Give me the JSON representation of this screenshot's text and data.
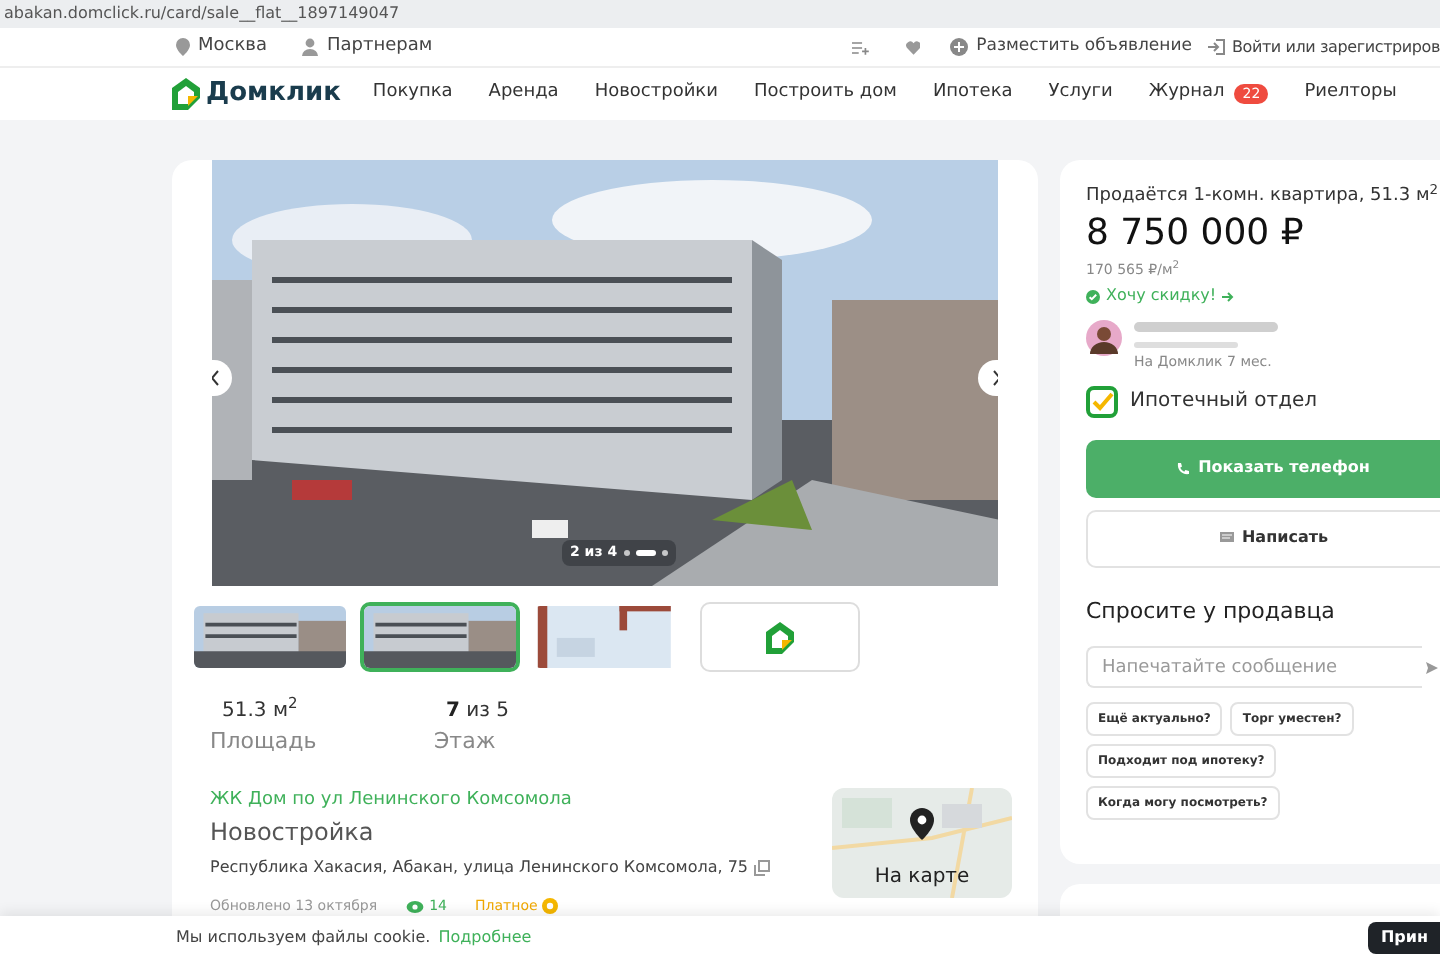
{
  "browser": {
    "url": "abakan.domclick.ru/card/sale__flat__1897149047"
  },
  "top_bar": {
    "city": "Москва",
    "partners": "Партнерам",
    "post_ad": "Разместить объявление",
    "login": "Войти или зарегистриров"
  },
  "nav": {
    "logo": "Домклик",
    "items": [
      {
        "label": "Покупка"
      },
      {
        "label": "Аренда"
      },
      {
        "label": "Новостройки"
      },
      {
        "label": "Построить дом"
      },
      {
        "label": "Ипотека"
      },
      {
        "label": "Услуги"
      },
      {
        "label": "Журнал",
        "badge": "22"
      },
      {
        "label": "Риелторы"
      }
    ]
  },
  "gallery": {
    "counter": "2 из 4",
    "slides": [
      {
        "selected": false
      },
      {
        "selected": true
      },
      {
        "selected": false
      }
    ],
    "thumbnails": [
      {
        "kind": "picture",
        "selected": false
      },
      {
        "kind": "picture",
        "selected": true
      },
      {
        "kind": "plan",
        "selected": false
      },
      {
        "kind": "logo",
        "selected": false
      }
    ]
  },
  "stats": [
    {
      "value": "51.3 м$^{2}$",
      "label": "Площадь"
    },
    {
      "value": "**7** из 5",
      "label": "Этаж"
    }
  ],
  "complex": {
    "name": "ЖК Дом по ул Ленинского Комсомола",
    "type": "Новостройка",
    "address": "Республика Хакасия, Абакан, улица Ленинского Комсомола, 75",
    "updated": "Обновлено 13 октября",
    "views": "14",
    "paid": "Платное",
    "map_button": "На карте"
  },
  "offer": {
    "title": "Продаётся 1-комн. квартира, 51.3 м$^{2}$",
    "price": "8 750 000 ₽",
    "price_per_m2": "170 565 ₽/м$^{2}$",
    "discount_link": "Хочу скидку!",
    "seller_since": "На Домклик 7 мес.",
    "department": "Ипотечный отдел",
    "show_phone": "Показать телефон",
    "write": "Написать"
  },
  "ask": {
    "title": "Спросите у продавца",
    "placeholder": "Напечатайте сообщение",
    "chips": [
      "Ещё актуально?",
      "Торг уместен?",
      "Подходит под ипотеку?",
      "Когда могу посмотреть?"
    ]
  },
  "cookie": {
    "text": "Мы используем файлы cookie.",
    "link": "Подробнее",
    "accept": "Прин"
  }
}
